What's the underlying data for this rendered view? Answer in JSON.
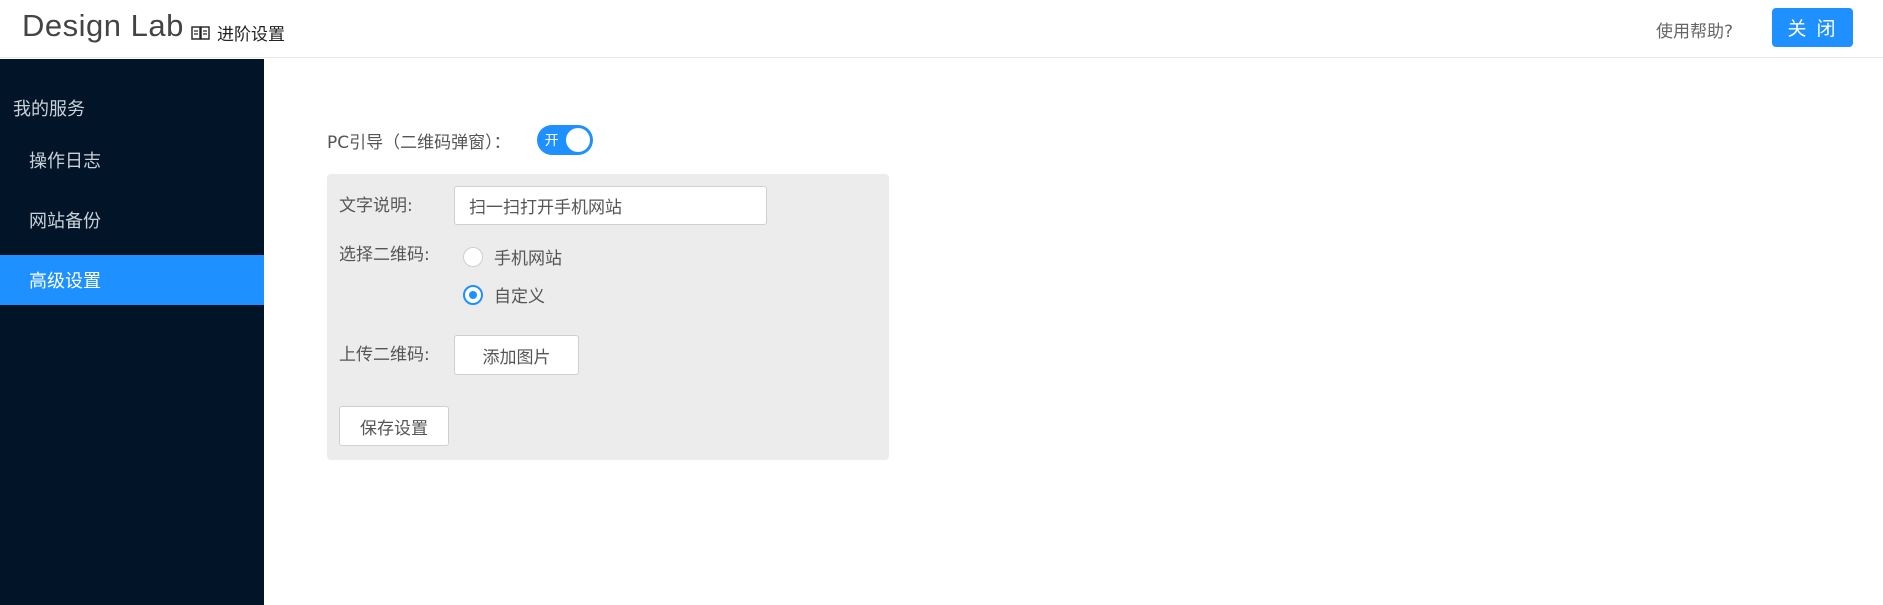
{
  "header": {
    "app_title": "Design Lab",
    "breadcrumb_label": "进阶设置",
    "help_link": "使用帮助?",
    "close_button": "关 闭"
  },
  "sidebar": {
    "section_title": "我的服务",
    "items": [
      {
        "label": "操作日志",
        "active": false
      },
      {
        "label": "网站备份",
        "active": false
      },
      {
        "label": "高级设置",
        "active": true
      }
    ]
  },
  "main": {
    "pc_guide": {
      "label": "PC引导（二维码弹窗）：",
      "toggle_text": "开",
      "toggle_on": true
    },
    "form": {
      "text_desc_label": "文字说明:",
      "text_desc_value": "扫一扫打开手机网站",
      "select_qr_label": "选择二维码:",
      "radio_options": [
        {
          "label": "手机网站",
          "checked": false
        },
        {
          "label": "自定义",
          "checked": true
        }
      ],
      "upload_qr_label": "上传二维码:",
      "add_image_button": "添加图片",
      "save_button": "保存设置"
    }
  },
  "colors": {
    "accent": "#1e90ff",
    "sidebar_bg": "#021427",
    "panel_bg": "#ececec"
  }
}
